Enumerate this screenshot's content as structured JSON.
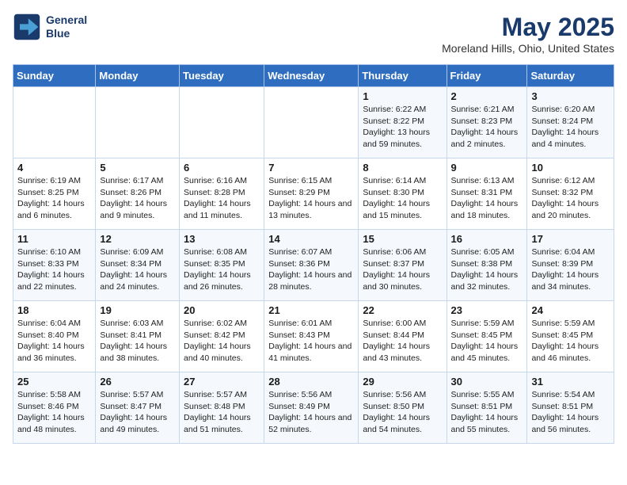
{
  "header": {
    "logo_line1": "General",
    "logo_line2": "Blue",
    "title": "May 2025",
    "subtitle": "Moreland Hills, Ohio, United States"
  },
  "days_of_week": [
    "Sunday",
    "Monday",
    "Tuesday",
    "Wednesday",
    "Thursday",
    "Friday",
    "Saturday"
  ],
  "weeks": [
    [
      {
        "day": "",
        "info": ""
      },
      {
        "day": "",
        "info": ""
      },
      {
        "day": "",
        "info": ""
      },
      {
        "day": "",
        "info": ""
      },
      {
        "day": "1",
        "info": "Sunrise: 6:22 AM\nSunset: 8:22 PM\nDaylight: 13 hours and 59 minutes."
      },
      {
        "day": "2",
        "info": "Sunrise: 6:21 AM\nSunset: 8:23 PM\nDaylight: 14 hours and 2 minutes."
      },
      {
        "day": "3",
        "info": "Sunrise: 6:20 AM\nSunset: 8:24 PM\nDaylight: 14 hours and 4 minutes."
      }
    ],
    [
      {
        "day": "4",
        "info": "Sunrise: 6:19 AM\nSunset: 8:25 PM\nDaylight: 14 hours and 6 minutes."
      },
      {
        "day": "5",
        "info": "Sunrise: 6:17 AM\nSunset: 8:26 PM\nDaylight: 14 hours and 9 minutes."
      },
      {
        "day": "6",
        "info": "Sunrise: 6:16 AM\nSunset: 8:28 PM\nDaylight: 14 hours and 11 minutes."
      },
      {
        "day": "7",
        "info": "Sunrise: 6:15 AM\nSunset: 8:29 PM\nDaylight: 14 hours and 13 minutes."
      },
      {
        "day": "8",
        "info": "Sunrise: 6:14 AM\nSunset: 8:30 PM\nDaylight: 14 hours and 15 minutes."
      },
      {
        "day": "9",
        "info": "Sunrise: 6:13 AM\nSunset: 8:31 PM\nDaylight: 14 hours and 18 minutes."
      },
      {
        "day": "10",
        "info": "Sunrise: 6:12 AM\nSunset: 8:32 PM\nDaylight: 14 hours and 20 minutes."
      }
    ],
    [
      {
        "day": "11",
        "info": "Sunrise: 6:10 AM\nSunset: 8:33 PM\nDaylight: 14 hours and 22 minutes."
      },
      {
        "day": "12",
        "info": "Sunrise: 6:09 AM\nSunset: 8:34 PM\nDaylight: 14 hours and 24 minutes."
      },
      {
        "day": "13",
        "info": "Sunrise: 6:08 AM\nSunset: 8:35 PM\nDaylight: 14 hours and 26 minutes."
      },
      {
        "day": "14",
        "info": "Sunrise: 6:07 AM\nSunset: 8:36 PM\nDaylight: 14 hours and 28 minutes."
      },
      {
        "day": "15",
        "info": "Sunrise: 6:06 AM\nSunset: 8:37 PM\nDaylight: 14 hours and 30 minutes."
      },
      {
        "day": "16",
        "info": "Sunrise: 6:05 AM\nSunset: 8:38 PM\nDaylight: 14 hours and 32 minutes."
      },
      {
        "day": "17",
        "info": "Sunrise: 6:04 AM\nSunset: 8:39 PM\nDaylight: 14 hours and 34 minutes."
      }
    ],
    [
      {
        "day": "18",
        "info": "Sunrise: 6:04 AM\nSunset: 8:40 PM\nDaylight: 14 hours and 36 minutes."
      },
      {
        "day": "19",
        "info": "Sunrise: 6:03 AM\nSunset: 8:41 PM\nDaylight: 14 hours and 38 minutes."
      },
      {
        "day": "20",
        "info": "Sunrise: 6:02 AM\nSunset: 8:42 PM\nDaylight: 14 hours and 40 minutes."
      },
      {
        "day": "21",
        "info": "Sunrise: 6:01 AM\nSunset: 8:43 PM\nDaylight: 14 hours and 41 minutes."
      },
      {
        "day": "22",
        "info": "Sunrise: 6:00 AM\nSunset: 8:44 PM\nDaylight: 14 hours and 43 minutes."
      },
      {
        "day": "23",
        "info": "Sunrise: 5:59 AM\nSunset: 8:45 PM\nDaylight: 14 hours and 45 minutes."
      },
      {
        "day": "24",
        "info": "Sunrise: 5:59 AM\nSunset: 8:45 PM\nDaylight: 14 hours and 46 minutes."
      }
    ],
    [
      {
        "day": "25",
        "info": "Sunrise: 5:58 AM\nSunset: 8:46 PM\nDaylight: 14 hours and 48 minutes."
      },
      {
        "day": "26",
        "info": "Sunrise: 5:57 AM\nSunset: 8:47 PM\nDaylight: 14 hours and 49 minutes."
      },
      {
        "day": "27",
        "info": "Sunrise: 5:57 AM\nSunset: 8:48 PM\nDaylight: 14 hours and 51 minutes."
      },
      {
        "day": "28",
        "info": "Sunrise: 5:56 AM\nSunset: 8:49 PM\nDaylight: 14 hours and 52 minutes."
      },
      {
        "day": "29",
        "info": "Sunrise: 5:56 AM\nSunset: 8:50 PM\nDaylight: 14 hours and 54 minutes."
      },
      {
        "day": "30",
        "info": "Sunrise: 5:55 AM\nSunset: 8:51 PM\nDaylight: 14 hours and 55 minutes."
      },
      {
        "day": "31",
        "info": "Sunrise: 5:54 AM\nSunset: 8:51 PM\nDaylight: 14 hours and 56 minutes."
      }
    ]
  ]
}
